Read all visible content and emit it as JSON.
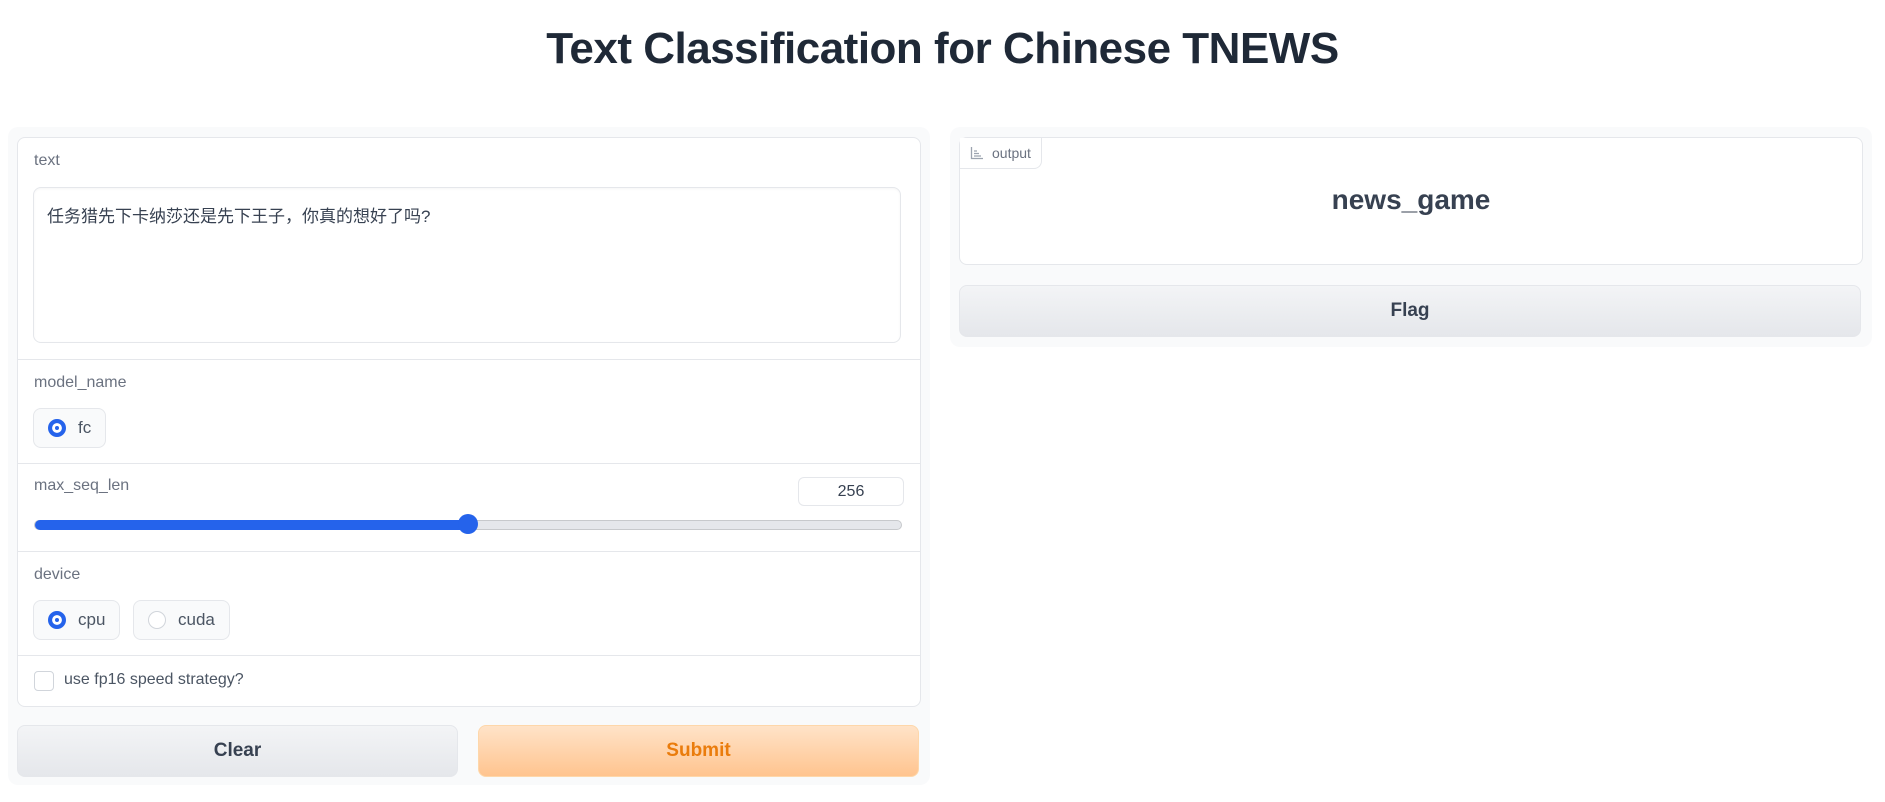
{
  "page": {
    "title": "Text Classification for Chinese TNEWS"
  },
  "inputs": {
    "text": {
      "label": "text",
      "value": "任务猎先下卡纳莎还是先下王子，你真的想好了吗?"
    },
    "model_name": {
      "label": "model_name",
      "options": [
        {
          "label": "fc",
          "selected": true
        }
      ]
    },
    "max_seq_len": {
      "label": "max_seq_len",
      "value": "256",
      "fill_fraction": 0.5
    },
    "device": {
      "label": "device",
      "options": [
        {
          "label": "cpu",
          "selected": true
        },
        {
          "label": "cuda",
          "selected": false
        }
      ]
    },
    "fp16": {
      "label": "use fp16 speed strategy?",
      "checked": false
    }
  },
  "buttons": {
    "clear": "Clear",
    "submit": "Submit",
    "flag": "Flag"
  },
  "output": {
    "tag": "output",
    "value": "news_game"
  },
  "colors": {
    "accent": "#2563eb",
    "submit_text": "#ea7c0c",
    "submit_bg": "#ffc48f"
  }
}
